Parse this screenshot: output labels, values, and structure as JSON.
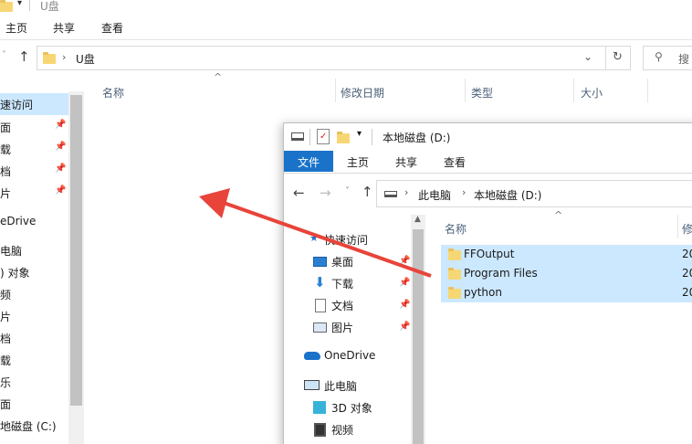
{
  "back_window": {
    "title": "U盘",
    "menu": [
      "主页",
      "共享",
      "查看"
    ],
    "address": "U盘",
    "search_placeholder": "搜",
    "columns": [
      "名称",
      "修改日期",
      "类型",
      "大小"
    ],
    "sidebar": [
      "速访问",
      "面",
      "载",
      "档",
      "片",
      "eDrive",
      "电脑",
      ") 对象",
      "频",
      "片",
      "档",
      "载",
      "乐",
      "面",
      "地磁盘 (C:)"
    ]
  },
  "front_window": {
    "title": "本地磁盘 (D:)",
    "menu": [
      "文件",
      "主页",
      "共享",
      "查看"
    ],
    "breadcrumb": [
      "此电脑",
      "本地磁盘 (D:)"
    ],
    "columns": [
      "名称",
      "修"
    ],
    "sidebar": {
      "quick_access": "快速访问",
      "items": [
        "桌面",
        "下载",
        "文档",
        "图片"
      ],
      "onedrive": "OneDrive",
      "this_pc": "此电脑",
      "pc_items": [
        "3D 对象",
        "视频"
      ]
    },
    "files": [
      {
        "name": "FFOutput",
        "date": "20"
      },
      {
        "name": "Program Files",
        "date": "20"
      },
      {
        "name": "python",
        "date": "20"
      }
    ]
  },
  "colors": {
    "accent": "#1a73c9",
    "selection": "#cce8ff",
    "arrow": "#e8443a"
  }
}
